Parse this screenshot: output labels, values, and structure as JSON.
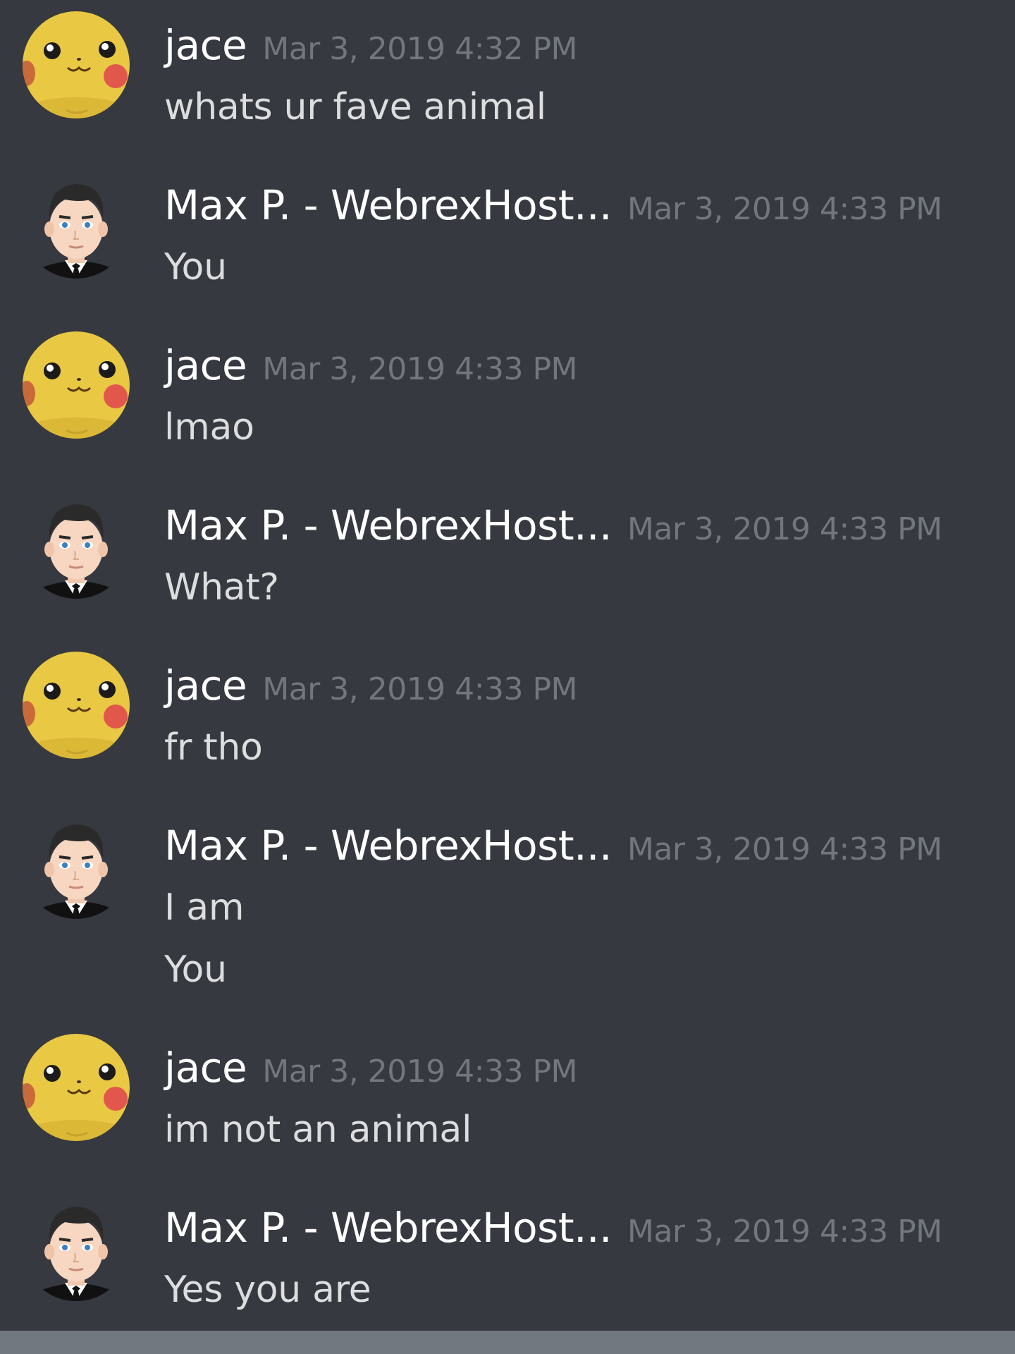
{
  "colors": {
    "background": "#36393f",
    "username": "#ffffff",
    "timestamp": "#72767d",
    "message_text": "#dcddde",
    "bottom_bar": "#72787f"
  },
  "messages": [
    {
      "author": "jace",
      "avatar": "pikachu-avatar-icon",
      "time": "Mar 3, 2019 4:32 PM",
      "lines": [
        "whats ur fave animal"
      ]
    },
    {
      "author": "Max P. - WebrexHost...",
      "avatar": "businessman-avatar-icon",
      "time": "Mar 3, 2019 4:33 PM",
      "lines": [
        "You"
      ]
    },
    {
      "author": "jace",
      "avatar": "pikachu-avatar-icon",
      "time": "Mar 3, 2019 4:33 PM",
      "lines": [
        "lmao"
      ]
    },
    {
      "author": "Max P. - WebrexHost...",
      "avatar": "businessman-avatar-icon",
      "time": "Mar 3, 2019 4:33 PM",
      "lines": [
        "What?"
      ]
    },
    {
      "author": "jace",
      "avatar": "pikachu-avatar-icon",
      "time": "Mar 3, 2019 4:33 PM",
      "lines": [
        "fr tho"
      ]
    },
    {
      "author": "Max P. - WebrexHost...",
      "avatar": "businessman-avatar-icon",
      "time": "Mar 3, 2019 4:33 PM",
      "lines": [
        "I am",
        "You"
      ]
    },
    {
      "author": "jace",
      "avatar": "pikachu-avatar-icon",
      "time": "Mar 3, 2019 4:33 PM",
      "lines": [
        "im not an animal"
      ]
    },
    {
      "author": "Max P. - WebrexHost...",
      "avatar": "businessman-avatar-icon",
      "time": "Mar 3, 2019 4:33 PM",
      "lines": [
        "Yes you are"
      ]
    }
  ]
}
